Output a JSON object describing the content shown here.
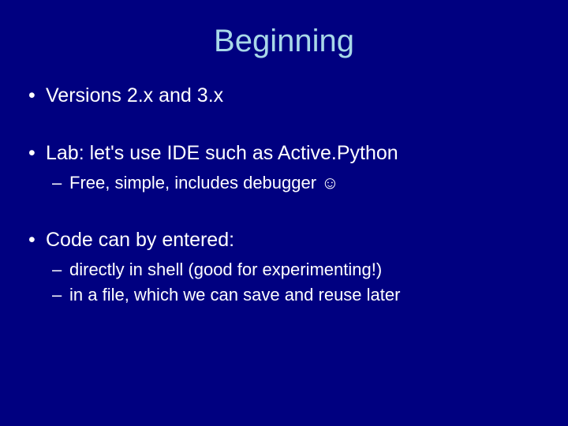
{
  "title": "Beginning",
  "bullets": [
    {
      "text": "Versions 2.x and 3.x",
      "children": []
    },
    {
      "text": "Lab:  let's use IDE such as Active.Python",
      "children": [
        {
          "text": "Free, simple, includes debugger ☺"
        }
      ]
    },
    {
      "text": "Code can by entered:",
      "children": [
        {
          "text": "directly in shell    (good for experimenting!)"
        },
        {
          "text": "in a file, which we can save and reuse later"
        }
      ]
    }
  ]
}
